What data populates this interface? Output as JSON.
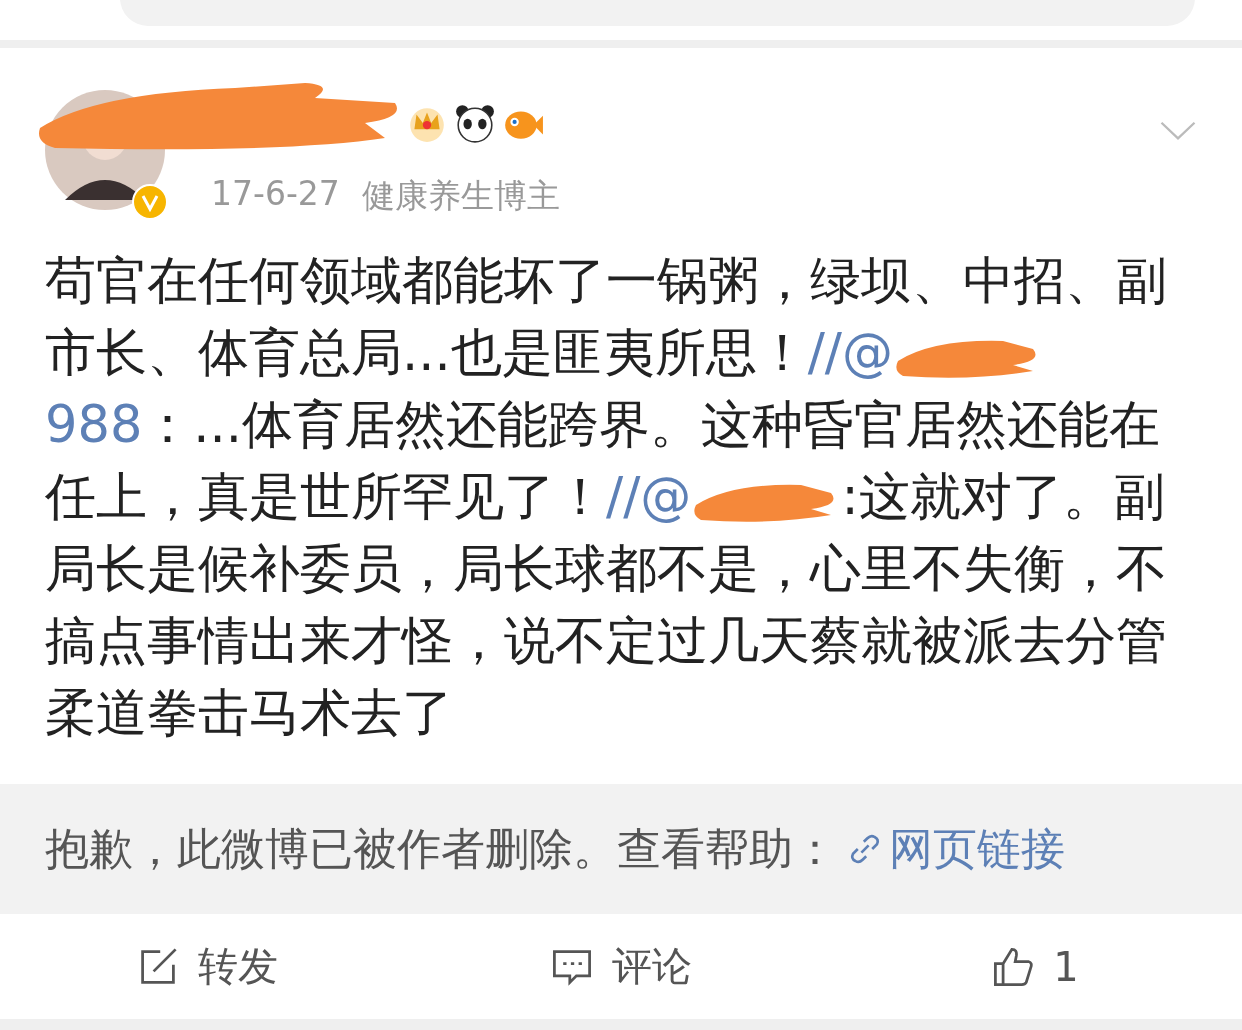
{
  "post": {
    "author_redacted": true,
    "verified": true,
    "time": "17-6-27",
    "source": "健康养生博主",
    "body": [
      {
        "kind": "text",
        "text": "苟官在任何领域都能坏了一锅粥，绿坝、中招、副市长、体育总局...也是匪夷所思！"
      },
      {
        "kind": "mention",
        "text": "//@"
      },
      {
        "kind": "redaction"
      },
      {
        "kind": "mention",
        "text": "988"
      },
      {
        "kind": "text",
        "text": "：...体育居然还能跨界。这种昏官居然还能在任上，真是世所罕见了！"
      },
      {
        "kind": "mention",
        "text": "//@"
      },
      {
        "kind": "redaction"
      },
      {
        "kind": "text",
        "text": ":这就对了。副局长是候补委员，局长球都不是，心里不失衡，不搞点事情出来才怪，说不定过几天蔡就被派去分管柔道拳击马术去了"
      }
    ],
    "repost": {
      "notice": "抱歉，此微博已被作者删除。查看帮助：",
      "link": "网页链接"
    }
  },
  "actions": [
    {
      "kind": "repost",
      "label": "转发"
    },
    {
      "kind": "comment",
      "label": "评论"
    },
    {
      "kind": "like",
      "label": "1"
    }
  ]
}
